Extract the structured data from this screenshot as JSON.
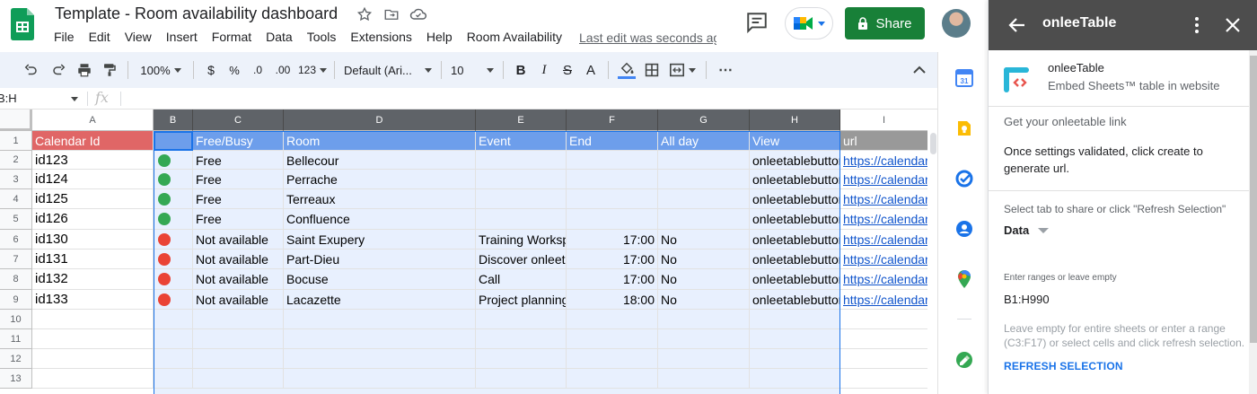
{
  "header": {
    "title": "Template - Room availability dashboard",
    "menu": [
      "File",
      "Edit",
      "View",
      "Insert",
      "Format",
      "Data",
      "Tools",
      "Extensions",
      "Help",
      "Room Availability"
    ],
    "last_edit": "Last edit was seconds ago",
    "share_label": "Share"
  },
  "toolbar": {
    "zoom": "100%",
    "currency": "$",
    "percent": "%",
    "dec_decrease": ".0",
    "dec_increase": ".00",
    "more_formats": "123",
    "font": "Default (Ari...",
    "font_size": "10",
    "bold": "B",
    "italic": "I",
    "strike": "S",
    "text_color": "A",
    "more": "⋯",
    "collapse": "^"
  },
  "formula_bar": {
    "name_box": "B:H",
    "fx": "fx"
  },
  "grid": {
    "columns": [
      "A",
      "B",
      "C",
      "D",
      "E",
      "F",
      "G",
      "H",
      "I"
    ],
    "selected_columns": [
      "B",
      "C",
      "D",
      "E",
      "F",
      "G",
      "H"
    ],
    "row_numbers": [
      "1",
      "2",
      "3",
      "4",
      "5",
      "6",
      "7",
      "8",
      "9",
      "10",
      "11",
      "12",
      "13"
    ],
    "header_row": [
      "Calendar Id",
      "",
      "Free/Busy",
      "Room",
      "Event",
      "End",
      "All day",
      "View",
      "url"
    ],
    "rows": [
      {
        "id": "id123",
        "status": "green",
        "free_busy": "Free",
        "room": "Bellecour",
        "event": "",
        "end": "",
        "all_day": "",
        "view": "onleetablebutton",
        "url": "https://calendar."
      },
      {
        "id": "id124",
        "status": "green",
        "free_busy": "Free",
        "room": "Perrache",
        "event": "",
        "end": "",
        "all_day": "",
        "view": "onleetablebutton",
        "url": "https://calendar."
      },
      {
        "id": "id125",
        "status": "green",
        "free_busy": "Free",
        "room": "Terreaux",
        "event": "",
        "end": "",
        "all_day": "",
        "view": "onleetablebutton",
        "url": "https://calendar."
      },
      {
        "id": "id126",
        "status": "green",
        "free_busy": "Free",
        "room": "Confluence",
        "event": "",
        "end": "",
        "all_day": "",
        "view": "onleetablebutton",
        "url": "https://calendar."
      },
      {
        "id": "id130",
        "status": "red",
        "free_busy": "Not available",
        "room": "Saint Exupery",
        "event": "Training Workspa",
        "end": "17:00",
        "all_day": "No",
        "view": "onleetablebutton",
        "url": "https://calendar."
      },
      {
        "id": "id131",
        "status": "red",
        "free_busy": "Not available",
        "room": "Part-Dieu",
        "event": "Discover onleeta",
        "end": "17:00",
        "all_day": "No",
        "view": "onleetablebutton",
        "url": "https://calendar."
      },
      {
        "id": "id132",
        "status": "red",
        "free_busy": "Not available",
        "room": "Bocuse",
        "event": "Call",
        "end": "17:00",
        "all_day": "No",
        "view": "onleetablebutton",
        "url": "https://calendar."
      },
      {
        "id": "id133",
        "status": "red",
        "free_busy": "Not available",
        "room": "Lacazette",
        "event": "Project planning",
        "end": "18:00",
        "all_day": "No",
        "view": "onleetablebutton",
        "url": "https://calendar."
      }
    ],
    "colors": {
      "header_id_bg": "#e06666",
      "header_bg": "#6d9eeb",
      "header_url_bg": "#999999",
      "selection_bg": "#e8f0fe",
      "green": "#34a853",
      "red": "#ea4335"
    }
  },
  "rail": {
    "icons": [
      "calendar-icon",
      "keep-icon",
      "tasks-icon",
      "contacts-icon",
      "maps-icon",
      "onleetable-addon-icon"
    ]
  },
  "panel": {
    "title": "onleeTable",
    "addon_name": "onleeTable",
    "addon_desc": "Embed Sheets™ table in website",
    "section_title": "Get your onleetable link",
    "info": "Once settings validated, click create to generate url.",
    "tab_label": "Select tab to share or click \"Refresh Selection\"",
    "tab_value": "Data",
    "ranges_label": "Enter ranges or leave empty",
    "ranges_value": "B1:H990",
    "hint": "Leave empty for entire sheets or enter a range (C3:F17) or select cells and click refresh selection.",
    "refresh_label": "REFRESH SELECTION",
    "header_bg": "#4d4d4d"
  }
}
